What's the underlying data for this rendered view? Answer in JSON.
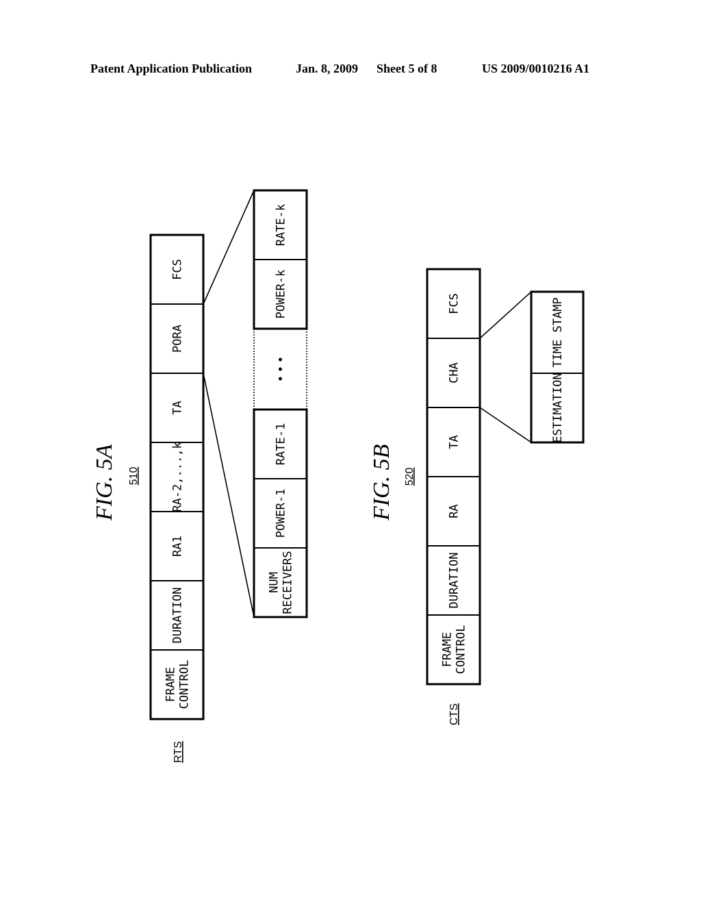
{
  "header": {
    "left": "Patent Application Publication",
    "date": "Jan. 8, 2009",
    "sheet": "Sheet 5 of 8",
    "pub_number": "US 2009/0010216 A1"
  },
  "fig5a": {
    "title": "FIG.  5A",
    "ref": "510",
    "frame_label": "RTS",
    "fields": [
      "FRAME|CONTROL",
      "DURATION",
      "RA1",
      "RA-2,...,k",
      "TA",
      "PORA",
      "FCS"
    ],
    "expanded_field": "PORA",
    "expansion_fields": [
      "NUM|RECEIVERS",
      "POWER-1",
      "RATE-1",
      "...",
      "POWER-k",
      "RATE-k"
    ]
  },
  "fig5b": {
    "title": "FIG.  5B",
    "ref": "520",
    "frame_label": "CTS",
    "fields": [
      "FRAME|CONTROL",
      "DURATION",
      "RA",
      "TA",
      "CHA",
      "FCS"
    ],
    "expanded_field": "CHA",
    "expansion_fields": [
      "ESTIMATION",
      "TIME  STAMP"
    ]
  }
}
